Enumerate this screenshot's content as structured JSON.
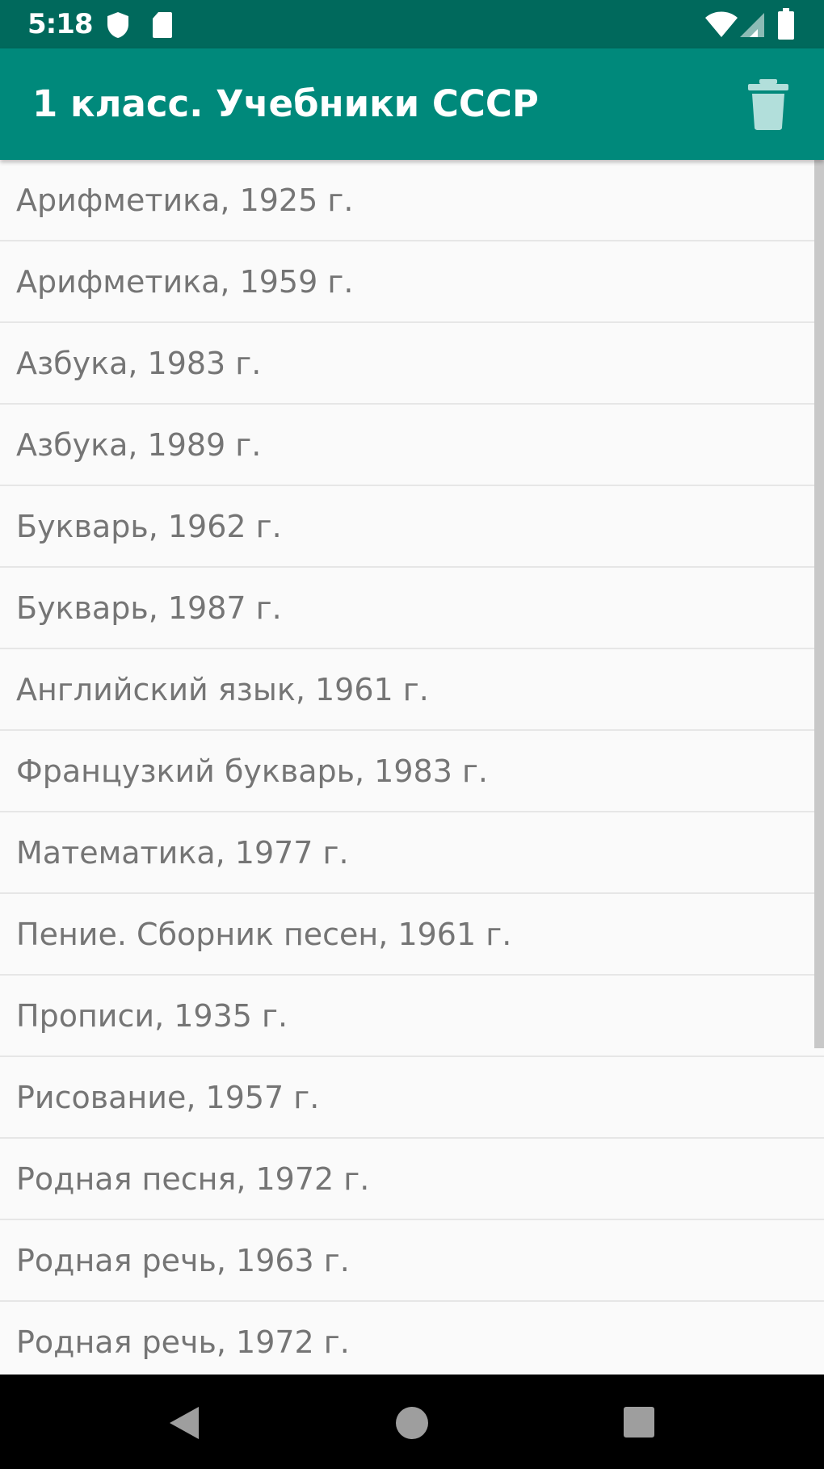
{
  "status_bar": {
    "time": "5:18",
    "icons": [
      "shield-icon",
      "sd-card-icon",
      "wifi-icon",
      "signal-icon",
      "battery-icon"
    ]
  },
  "app_bar": {
    "title": "1 класс. Учебники СССР",
    "action_icon": "trash-icon"
  },
  "list": {
    "items": [
      {
        "label": "Арифметика, 1925 г."
      },
      {
        "label": "Арифметика, 1959 г."
      },
      {
        "label": "Азбука, 1983 г."
      },
      {
        "label": "Азбука, 1989 г."
      },
      {
        "label": "Букварь, 1962 г."
      },
      {
        "label": "Букварь, 1987 г."
      },
      {
        "label": "Английский язык, 1961 г."
      },
      {
        "label": "Французкий букварь, 1983 г."
      },
      {
        "label": "Математика, 1977 г."
      },
      {
        "label": "Пение. Сборник песен, 1961 г."
      },
      {
        "label": "Прописи, 1935 г."
      },
      {
        "label": "Рисование, 1957 г."
      },
      {
        "label": "Родная песня, 1972 г."
      },
      {
        "label": "Родная речь, 1963 г."
      },
      {
        "label": "Родная речь, 1972 г."
      }
    ]
  },
  "nav_bar": {
    "icons": [
      "back-icon",
      "home-icon",
      "recents-icon"
    ]
  },
  "colors": {
    "status_bar": "#00695c",
    "app_bar": "#00897b",
    "background": "#fafafa",
    "list_text": "#757575",
    "divider": "#e6e6e6",
    "nav_bar": "#000000"
  }
}
